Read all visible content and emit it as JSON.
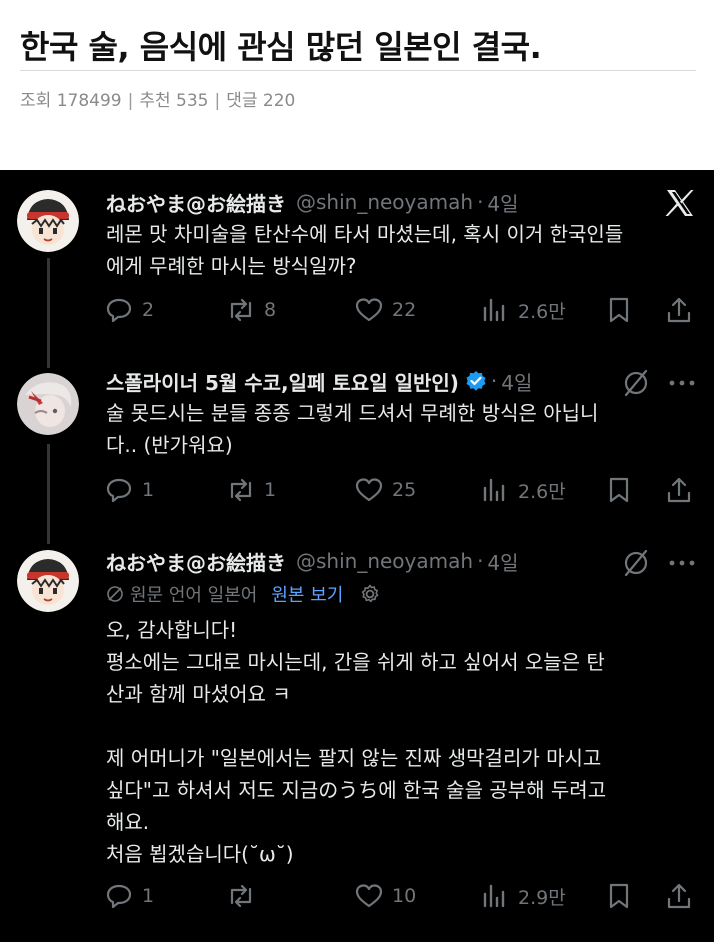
{
  "post": {
    "title": "한국 술, 음식에 관심 많던 일본인 결국.",
    "views_label": "조회",
    "views": "178499",
    "likes_label": "추천",
    "likes": "535",
    "comments_label": "댓글",
    "comments": "220"
  },
  "tweets": [
    {
      "name": "ねおやま@お絵描き",
      "handle": "@shin_neoyamah",
      "time": "4일",
      "body": [
        "레몬 맛 차미술을 탄산수에 타서 마셨는데, 혹시 이거 한국인들",
        "에게 무례한 마시는 방식일까?"
      ],
      "replies": "2",
      "retweets": "8",
      "likes": "22",
      "views": "2.6만"
    },
    {
      "name": "스폴라이너 5월 수코,일페 토요일 일반인)",
      "handle": "",
      "time": "4일",
      "body": [
        "술 못드시는 분들 종종 그렇게 드셔서 무례한 방식은 아닙니",
        "다.. (반가워요)"
      ],
      "replies": "1",
      "retweets": "1",
      "likes": "25",
      "views": "2.6만"
    },
    {
      "name": "ねおやま@お絵描き",
      "handle": "@shin_neoyamah",
      "time": "4일",
      "translation_note": "원문 언어 일본어",
      "translation_link": "원본 보기",
      "body": [
        "오, 감사합니다!",
        "평소에는 그대로 마시는데, 간을 쉬게 하고 싶어서 오늘은 탄",
        "산과 함께 마셨어요 ㅋ",
        "",
        "제 어머니가 \"일본에서는 팔지 않는 진짜 생막걸리가 마시고",
        "싶다\"고 하셔서 저도 지금のうち에 한국 술을 공부해 두려고",
        "해요.",
        "처음 뵙겠습니다(˘ω˘)"
      ],
      "replies": "1",
      "retweets": "",
      "likes": "10",
      "views": "2.9만"
    }
  ],
  "colors": {
    "background": "#000000",
    "text": "#e7e9ea",
    "muted": "#71767b",
    "link": "#5da2ff",
    "verified": "#1d9bf0"
  },
  "icons": [
    "x-logo-icon",
    "grok-icon",
    "more-icon",
    "reply-icon",
    "retweet-icon",
    "like-icon",
    "views-icon",
    "bookmark-icon",
    "share-icon",
    "globe-icon",
    "gear-icon",
    "verified-badge-icon"
  ]
}
